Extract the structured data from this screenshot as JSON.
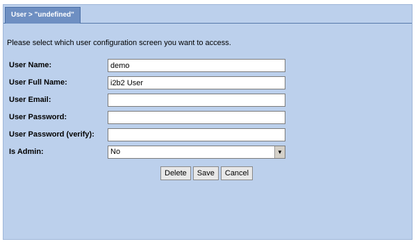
{
  "tab": {
    "label": "User > \"undefined\""
  },
  "intro_text": "Please select which user configuration screen you want to access.",
  "form": {
    "username": {
      "label": "User Name:",
      "value": "demo"
    },
    "full_name": {
      "label": "User Full Name:",
      "value": "i2b2 User"
    },
    "email": {
      "label": "User Email:",
      "value": ""
    },
    "password": {
      "label": "User Password:",
      "value": ""
    },
    "password_verify": {
      "label": "User Password (verify):",
      "value": ""
    },
    "is_admin": {
      "label": "Is Admin:",
      "value": "No"
    }
  },
  "buttons": {
    "delete": "Delete",
    "save": "Save",
    "cancel": "Cancel"
  },
  "colors": {
    "panel_bg": "#bcd0ec",
    "tab_bg": "#6e8fc2"
  }
}
